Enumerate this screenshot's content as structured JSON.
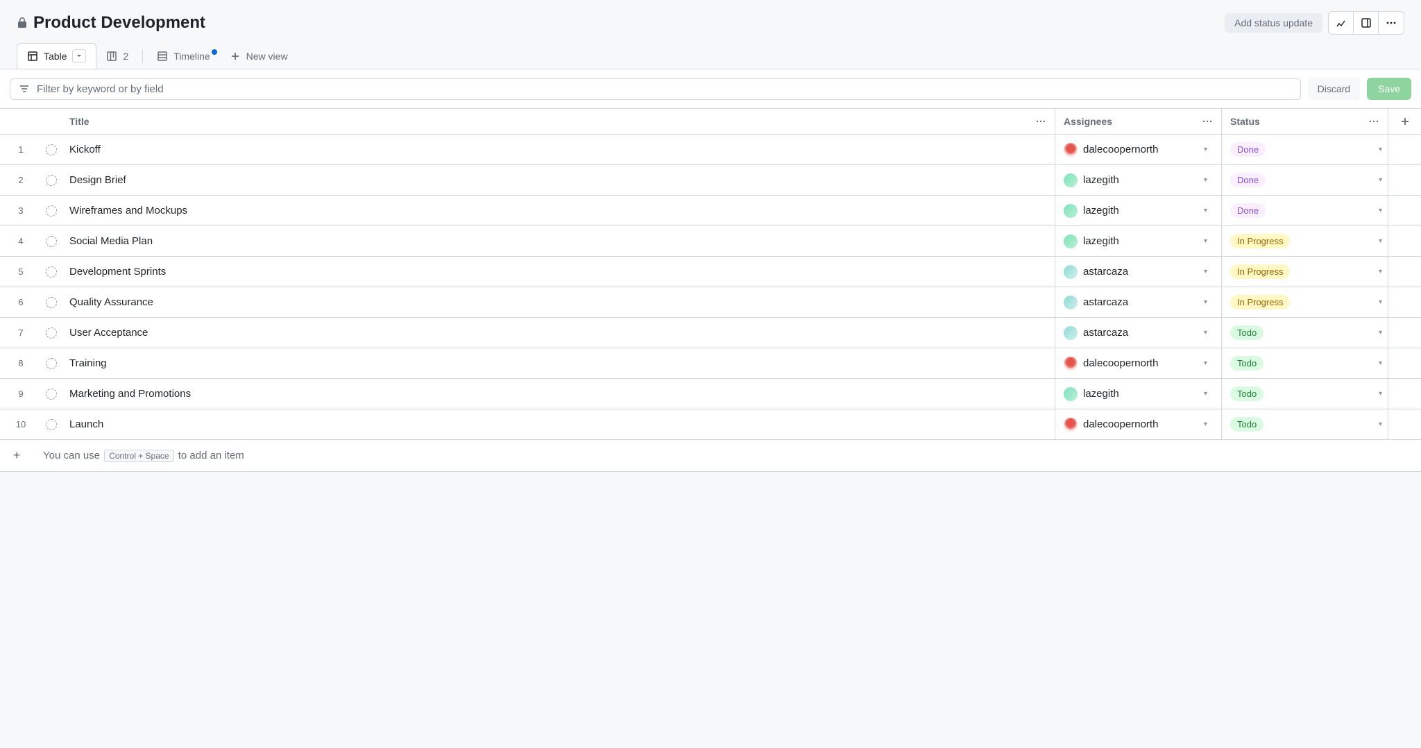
{
  "header": {
    "title": "Product Development",
    "status_update_label": "Add status update"
  },
  "tabs": {
    "table_label": "Table",
    "board_label": "2",
    "timeline_label": "Timeline",
    "new_view_label": "New view"
  },
  "filter": {
    "placeholder": "Filter by keyword or by field",
    "discard_label": "Discard",
    "save_label": "Save"
  },
  "columns": {
    "title": "Title",
    "assignees": "Assignees",
    "status": "Status"
  },
  "rows": [
    {
      "n": "1",
      "title": "Kickoff",
      "assignee": "dalecoopernorth",
      "avatar": "red",
      "status": "Done",
      "status_class": "status-done"
    },
    {
      "n": "2",
      "title": "Design Brief",
      "assignee": "lazegith",
      "avatar": "green",
      "status": "Done",
      "status_class": "status-done"
    },
    {
      "n": "3",
      "title": "Wireframes and Mockups",
      "assignee": "lazegith",
      "avatar": "green",
      "status": "Done",
      "status_class": "status-done"
    },
    {
      "n": "4",
      "title": "Social Media Plan",
      "assignee": "lazegith",
      "avatar": "green",
      "status": "In Progress",
      "status_class": "status-inprogress"
    },
    {
      "n": "5",
      "title": "Development Sprints",
      "assignee": "astarcaza",
      "avatar": "teal",
      "status": "In Progress",
      "status_class": "status-inprogress"
    },
    {
      "n": "6",
      "title": "Quality Assurance",
      "assignee": "astarcaza",
      "avatar": "teal",
      "status": "In Progress",
      "status_class": "status-inprogress"
    },
    {
      "n": "7",
      "title": "User Acceptance",
      "assignee": "astarcaza",
      "avatar": "teal",
      "status": "Todo",
      "status_class": "status-todo"
    },
    {
      "n": "8",
      "title": "Training",
      "assignee": "dalecoopernorth",
      "avatar": "red",
      "status": "Todo",
      "status_class": "status-todo"
    },
    {
      "n": "9",
      "title": "Marketing and Promotions",
      "assignee": "lazegith",
      "avatar": "green",
      "status": "Todo",
      "status_class": "status-todo"
    },
    {
      "n": "10",
      "title": "Launch",
      "assignee": "dalecoopernorth",
      "avatar": "red",
      "status": "Todo",
      "status_class": "status-todo"
    }
  ],
  "footer": {
    "prefix": "You can use ",
    "kbd": "Control + Space",
    "suffix": " to add an item"
  }
}
